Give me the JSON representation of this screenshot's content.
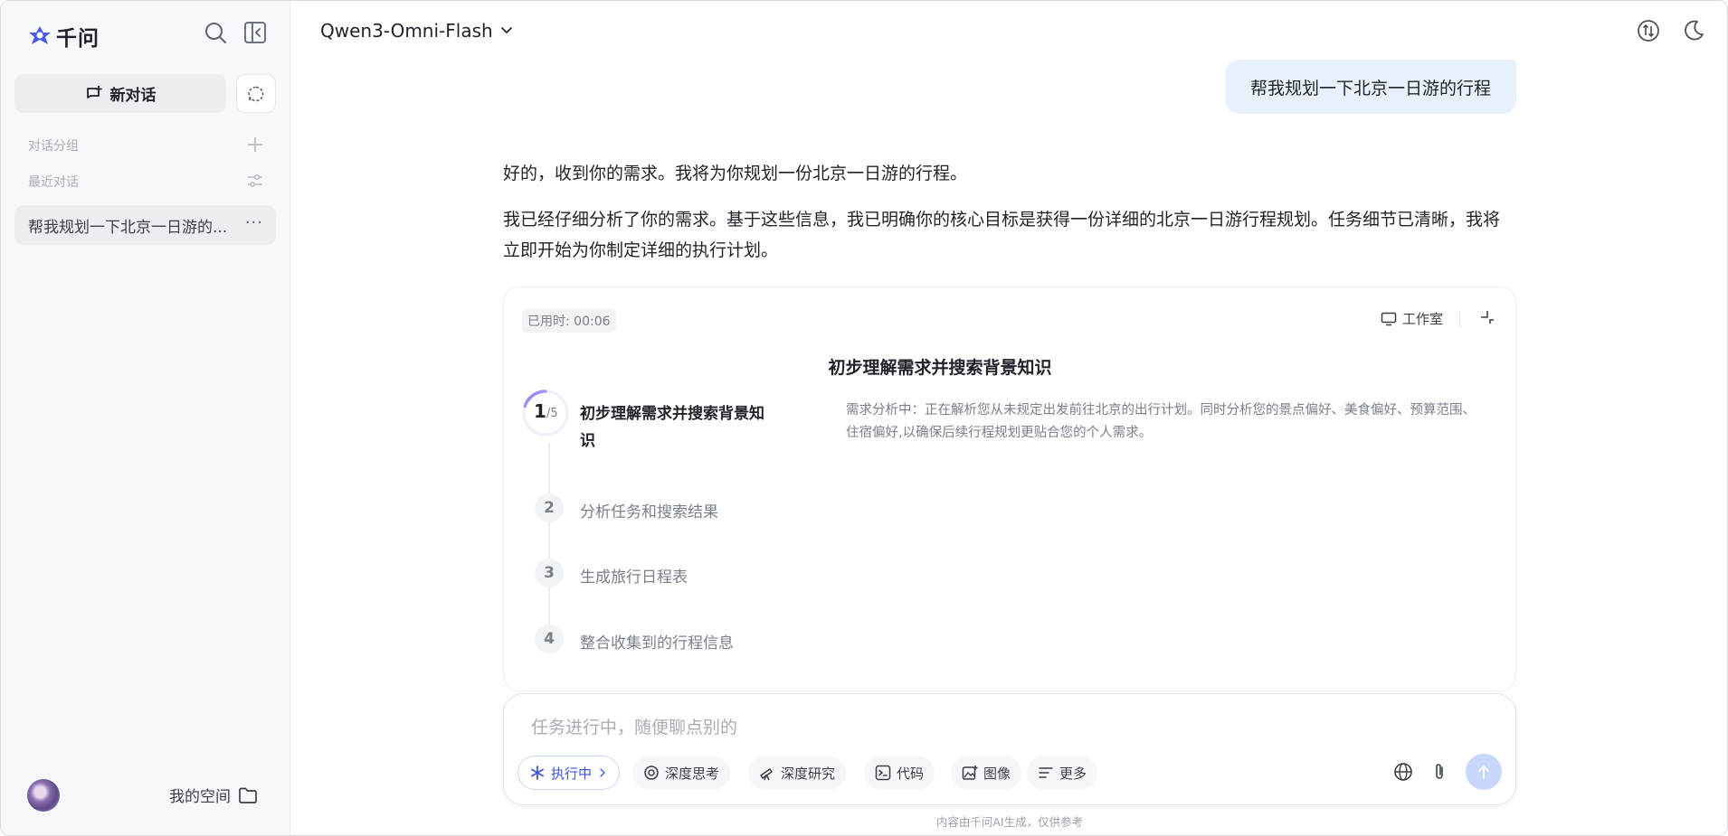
{
  "app": {
    "logo_text": "千问"
  },
  "sidebar": {
    "new_chat_label": "新对话",
    "groups_label": "对话分组",
    "recent_label": "最近对话",
    "recent_items": [
      {
        "title": "帮我规划一下北京一日游的..."
      }
    ],
    "my_space_label": "我的空间"
  },
  "header": {
    "model_name": "Qwen3-Omni-Flash"
  },
  "chat": {
    "user_message": "帮我规划一下北京一日游的行程",
    "assistant_paragraph_1": "好的，收到你的需求。我将为你规划一份北京一日游的行程。",
    "assistant_paragraph_2": "我已经仔细分析了你的需求。基于这些信息，我已明确你的核心目标是获得一份详细的北京一日游行程规划。任务细节已清晰，我将立即开始为你制定详细的执行计划。"
  },
  "task_card": {
    "elapsed": "已用时: 00:06",
    "studio_label": "工作室",
    "current_title": "初步理解需求并搜索背景知识",
    "progress": {
      "current": "1",
      "total": "/5",
      "fraction": 0.2
    },
    "active_step": {
      "label": "初步理解需求并搜索背景知识",
      "description": "需求分析中：正在解析您从未规定出发前往北京的出行计划。同时分析您的景点偏好、美食偏好、预算范围、住宿偏好,以确保后续行程规划更贴合您的个人需求。"
    },
    "steps": [
      {
        "num": "2",
        "label": "分析任务和搜索结果"
      },
      {
        "num": "3",
        "label": "生成旅行日程表"
      },
      {
        "num": "4",
        "label": "整合收集到的行程信息"
      }
    ]
  },
  "input": {
    "placeholder": "任务进行中，随便聊点别的",
    "running_chip": "执行中",
    "chips": [
      {
        "label": "深度思考",
        "icon": "deep-think-icon"
      },
      {
        "label": "深度研究",
        "icon": "telescope-icon"
      },
      {
        "label": "代码",
        "icon": "code-icon"
      },
      {
        "label": "图像",
        "icon": "image-icon"
      },
      {
        "label": "更多",
        "icon": "more-lines-icon"
      }
    ]
  },
  "footer": {
    "disclaimer": "内容由千问AI生成，仅供参考"
  },
  "colors": {
    "accent": "#3c56d8",
    "user_bubble": "#e8f0fc",
    "send_button": "#c9d6fb"
  }
}
